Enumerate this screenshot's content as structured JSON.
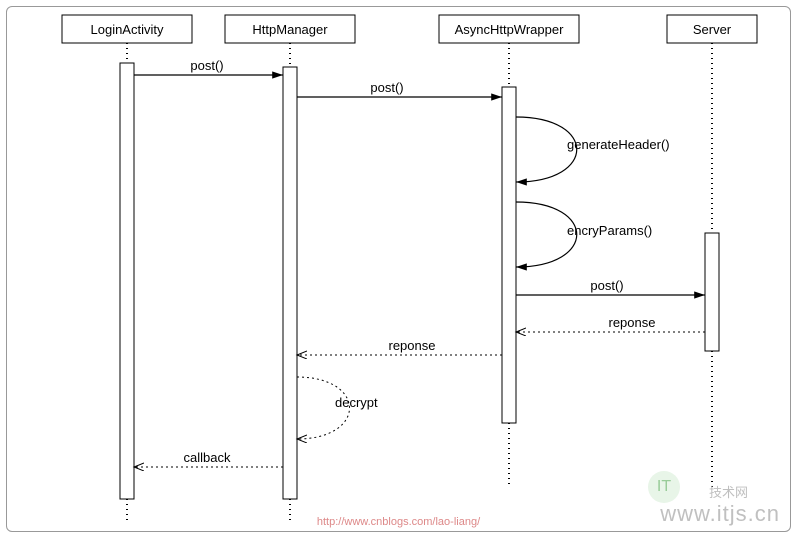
{
  "participants": {
    "p1": "LoginActivity",
    "p2": "HttpManager",
    "p3": "AsyncHttpWrapper",
    "p4": "Server"
  },
  "messages": {
    "m1": "post()",
    "m2": "post()",
    "m3": "generateHeader()",
    "m4": "encryParams()",
    "m5": "post()",
    "m6": "reponse",
    "m7": "reponse",
    "m8": "decrypt",
    "m9": "callback"
  },
  "credit": "http://www.cnblogs.com/lao-liang/",
  "watermark": {
    "logo": "IT",
    "sub": "技术网",
    "url": "www.itjs.cn"
  },
  "chart_data": {
    "type": "sequence-diagram",
    "participants": [
      "LoginActivity",
      "HttpManager",
      "AsyncHttpWrapper",
      "Server"
    ],
    "messages": [
      {
        "from": "LoginActivity",
        "to": "HttpManager",
        "label": "post()",
        "kind": "sync"
      },
      {
        "from": "HttpManager",
        "to": "AsyncHttpWrapper",
        "label": "post()",
        "kind": "sync"
      },
      {
        "from": "AsyncHttpWrapper",
        "to": "AsyncHttpWrapper",
        "label": "generateHeader()",
        "kind": "self"
      },
      {
        "from": "AsyncHttpWrapper",
        "to": "AsyncHttpWrapper",
        "label": "encryParams()",
        "kind": "self"
      },
      {
        "from": "AsyncHttpWrapper",
        "to": "Server",
        "label": "post()",
        "kind": "sync"
      },
      {
        "from": "Server",
        "to": "AsyncHttpWrapper",
        "label": "reponse",
        "kind": "return"
      },
      {
        "from": "AsyncHttpWrapper",
        "to": "HttpManager",
        "label": "reponse",
        "kind": "return"
      },
      {
        "from": "HttpManager",
        "to": "HttpManager",
        "label": "decrypt",
        "kind": "self-return"
      },
      {
        "from": "HttpManager",
        "to": "LoginActivity",
        "label": "callback",
        "kind": "return"
      }
    ]
  }
}
